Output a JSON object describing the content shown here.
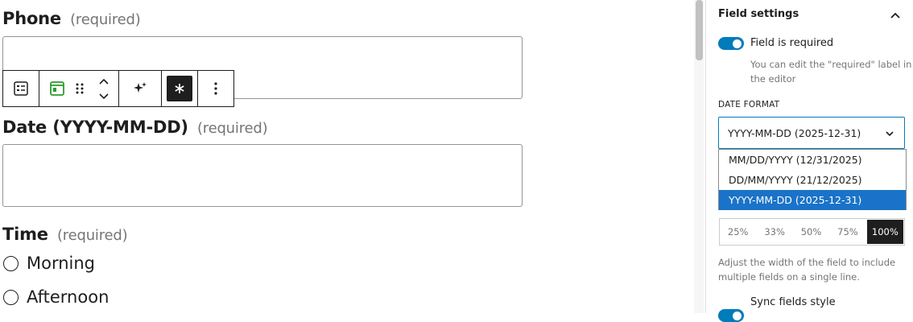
{
  "editor": {
    "phone_field": {
      "label": "Phone",
      "required": "(required)"
    },
    "date_field": {
      "label": "Date (YYYY-MM-DD)",
      "required": "(required)"
    },
    "time_field": {
      "label": "Time",
      "required": "(required)",
      "options": [
        "Morning",
        "Afternoon"
      ]
    },
    "toolbar": {
      "block_type_icon": "form-field-icon",
      "parent_icon": "form-block-icon",
      "drag_icon": "drag-handle-icon",
      "move_up_icon": "chevron-up-icon",
      "move_down_icon": "chevron-down-icon",
      "ai_icon": "sparkle-icon",
      "required_icon": "asterisk-icon",
      "more_icon": "more-vertical-icon",
      "required_active": true
    }
  },
  "sidebar": {
    "panel_title": "Field settings",
    "required_toggle": {
      "label": "Field is required",
      "on": true
    },
    "required_help": [
      "You can edit the \"required\" label in",
      "the editor"
    ],
    "date_format": {
      "label": "Date format",
      "selected": "YYYY-MM-DD (2025-12-31)",
      "options": [
        "MM/DD/YYYY (12/31/2025)",
        "DD/MM/YYYY (21/12/2025)",
        "YYYY-MM-DD (2025-12-31)"
      ],
      "selected_index": 2
    },
    "width": {
      "options": [
        "25%",
        "33%",
        "50%",
        "75%",
        "100%"
      ],
      "selected": "100%",
      "help": [
        "Adjust the width of the field to include",
        "multiple fields on a single line."
      ]
    },
    "sync_toggle": {
      "label": "Sync fields style",
      "on": true
    }
  },
  "colors": {
    "accent": "#007cba",
    "dropdown_highlight": "#1a73c8",
    "toolbar_active": "#1e1e1e",
    "form_icon_green": "#2e9b2e"
  }
}
